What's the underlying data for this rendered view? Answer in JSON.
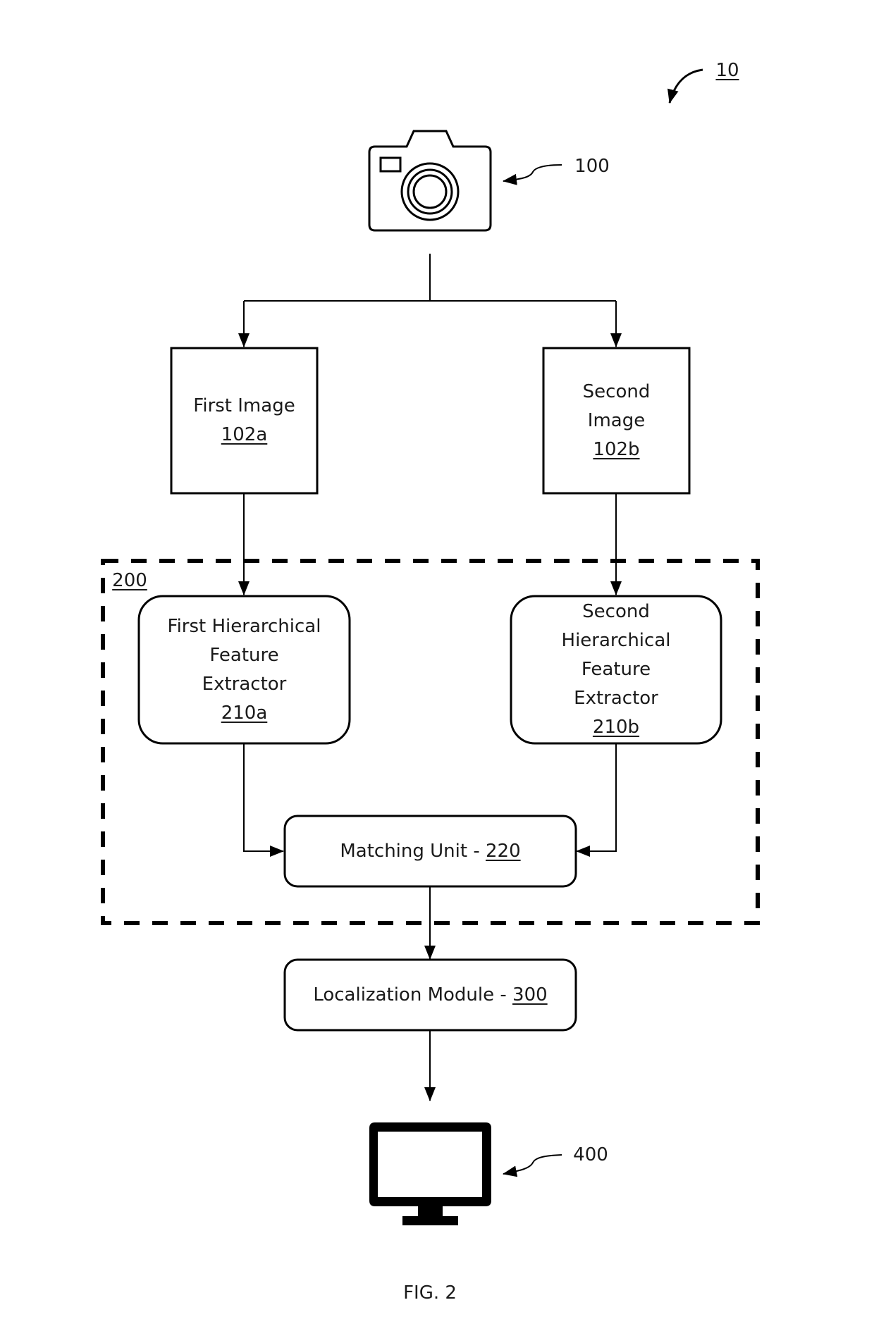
{
  "figure": {
    "caption": "FIG. 2",
    "system_ref": "10",
    "colors": {
      "stroke": "#000000",
      "background": "#ffffff",
      "text": "#1a1a1a"
    }
  },
  "nodes": {
    "camera": {
      "icon": "camera-icon",
      "ref": "100"
    },
    "first_image": {
      "lines": [
        "First Image"
      ],
      "ref": "102a"
    },
    "second_image": {
      "lines": [
        "Second",
        "Image"
      ],
      "ref": "102b"
    },
    "group": {
      "ref": "200"
    },
    "first_extractor": {
      "lines": [
        "First Hierarchical",
        "Feature",
        "Extractor"
      ],
      "ref": "210a"
    },
    "second_extractor": {
      "lines": [
        "Second",
        "Hierarchical",
        "Feature",
        "Extractor"
      ],
      "ref": "210b"
    },
    "matching_unit": {
      "label": "Matching Unit - ",
      "ref": "220"
    },
    "localization_module": {
      "label": "Localization Module - ",
      "ref": "300"
    },
    "display": {
      "icon": "monitor-icon",
      "ref": "400"
    }
  },
  "edges": [
    {
      "from": "camera",
      "to": "first_image"
    },
    {
      "from": "camera",
      "to": "second_image"
    },
    {
      "from": "first_image",
      "to": "first_extractor"
    },
    {
      "from": "second_image",
      "to": "second_extractor"
    },
    {
      "from": "first_extractor",
      "to": "matching_unit"
    },
    {
      "from": "second_extractor",
      "to": "matching_unit"
    },
    {
      "from": "matching_unit",
      "to": "localization_module"
    },
    {
      "from": "localization_module",
      "to": "display"
    }
  ]
}
